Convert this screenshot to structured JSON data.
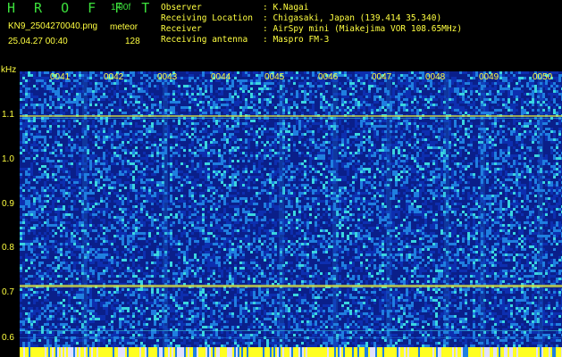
{
  "header": {
    "brand": "H R O F F T",
    "version": "1.00f",
    "filename": "KN9_2504270040.png",
    "mode": "meteor",
    "timestamp": "25.04.27 00:40",
    "count": "128"
  },
  "info": [
    {
      "key": "Observer",
      "value": ": K.Nagai"
    },
    {
      "key": "Receiving Location",
      "value": ": Chigasaki, Japan (139.414 35.340)"
    },
    {
      "key": "Receiver",
      "value": ": AirSpy mini (Miakejima VOR 108.65MHz)"
    },
    {
      "key": "Receiving antenna",
      "value": ": Maspro FM-3"
    }
  ],
  "axis": {
    "unit": "kHz",
    "y_ticks": [
      "1.1",
      "1.0",
      "0.9",
      "0.8",
      "0.7",
      "0.6"
    ],
    "x_ticks": [
      "0041",
      "0042",
      "0043",
      "0044",
      "0045",
      "0046",
      "0047",
      "0048",
      "0049",
      "0050"
    ]
  },
  "colors": {
    "background": "#0a1f8a",
    "noise_low": "#0d2fb0",
    "noise_mid": "#1f7fe0",
    "noise_high": "#3ad6e0",
    "signal": "#d8e040",
    "text_yellow": "#ffff40",
    "text_green": "#3ce03c"
  }
}
